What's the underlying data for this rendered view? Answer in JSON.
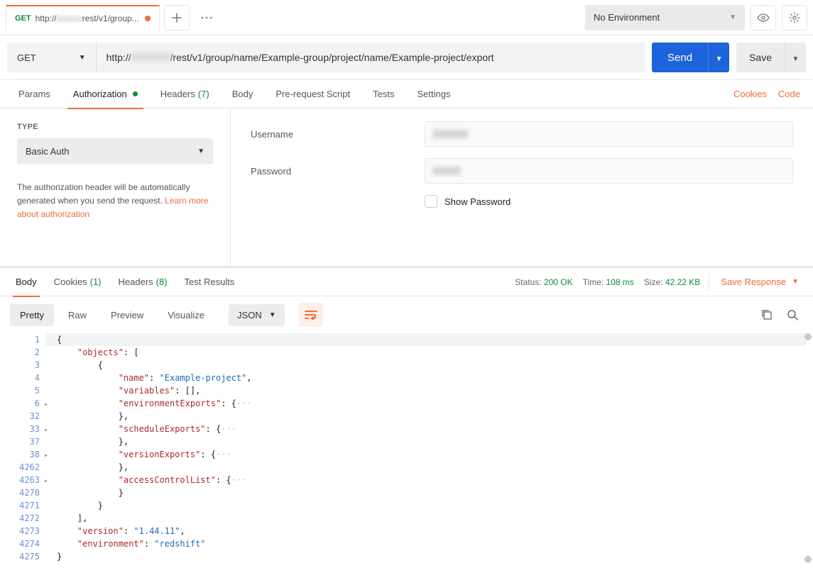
{
  "tab": {
    "method": "GET",
    "title_prefix": "http://",
    "title_blur": "xxxxxx",
    "title_suffix": "rest/v1/group..."
  },
  "env": {
    "label": "No Environment"
  },
  "request": {
    "method": "GET",
    "url_prefix": "http://",
    "url_suffix": "/rest/v1/group/name/Example-group/project/name/Example-project/export"
  },
  "buttons": {
    "send": "Send",
    "save": "Save"
  },
  "reqTabs": {
    "params": "Params",
    "auth": "Authorization",
    "headers": "Headers",
    "headers_count": "(7)",
    "body": "Body",
    "prerequest": "Pre-request Script",
    "tests": "Tests",
    "settings": "Settings",
    "cookies": "Cookies",
    "code": "Code"
  },
  "auth": {
    "type_label": "TYPE",
    "type_value": "Basic Auth",
    "desc_1": "The authorization header will be automatically generated when you send the request. ",
    "desc_link": "Learn more about authorization",
    "username_label": "Username",
    "password_label": "Password",
    "show_password": "Show Password"
  },
  "respTabs": {
    "body": "Body",
    "cookies": "Cookies",
    "cookies_count": "(1)",
    "headers": "Headers",
    "headers_count": "(8)",
    "tests": "Test Results"
  },
  "respMeta": {
    "status_label": "Status:",
    "status_value": "200 OK",
    "time_label": "Time:",
    "time_value": "108 ms",
    "size_label": "Size:",
    "size_value": "42.22 KB",
    "save_response": "Save Response"
  },
  "fmt": {
    "pretty": "Pretty",
    "raw": "Raw",
    "preview": "Preview",
    "visualize": "Visualize",
    "lang": "JSON"
  },
  "code": {
    "lines": [
      {
        "n": "1",
        "indent": 0,
        "content": [
          {
            "t": "p",
            "v": "{"
          }
        ],
        "hl": true
      },
      {
        "n": "2",
        "indent": 1,
        "content": [
          {
            "t": "k",
            "v": "\"objects\""
          },
          {
            "t": "p",
            "v": ": ["
          }
        ]
      },
      {
        "n": "3",
        "indent": 2,
        "content": [
          {
            "t": "p",
            "v": "{"
          }
        ]
      },
      {
        "n": "4",
        "indent": 3,
        "content": [
          {
            "t": "k",
            "v": "\"name\""
          },
          {
            "t": "p",
            "v": ": "
          },
          {
            "t": "s",
            "v": "\"Example-project\""
          },
          {
            "t": "p",
            "v": ","
          }
        ]
      },
      {
        "n": "5",
        "indent": 3,
        "content": [
          {
            "t": "k",
            "v": "\"variables\""
          },
          {
            "t": "p",
            "v": ": [],"
          }
        ]
      },
      {
        "n": "6",
        "indent": 3,
        "fold": true,
        "content": [
          {
            "t": "k",
            "v": "\"environmentExports\""
          },
          {
            "t": "p",
            "v": ": {"
          },
          {
            "t": "d",
            "v": "···"
          }
        ]
      },
      {
        "n": "32",
        "indent": 3,
        "content": [
          {
            "t": "p",
            "v": "},"
          }
        ]
      },
      {
        "n": "33",
        "indent": 3,
        "fold": true,
        "content": [
          {
            "t": "k",
            "v": "\"scheduleExports\""
          },
          {
            "t": "p",
            "v": ": {"
          },
          {
            "t": "d",
            "v": "···"
          }
        ]
      },
      {
        "n": "37",
        "indent": 3,
        "content": [
          {
            "t": "p",
            "v": "},"
          }
        ]
      },
      {
        "n": "38",
        "indent": 3,
        "fold": true,
        "content": [
          {
            "t": "k",
            "v": "\"versionExports\""
          },
          {
            "t": "p",
            "v": ": {"
          },
          {
            "t": "d",
            "v": "···"
          }
        ]
      },
      {
        "n": "4262",
        "indent": 3,
        "content": [
          {
            "t": "p",
            "v": "},"
          }
        ]
      },
      {
        "n": "4263",
        "indent": 3,
        "fold": true,
        "content": [
          {
            "t": "k",
            "v": "\"accessControlList\""
          },
          {
            "t": "p",
            "v": ": {"
          },
          {
            "t": "d",
            "v": "···"
          }
        ]
      },
      {
        "n": "4270",
        "indent": 3,
        "content": [
          {
            "t": "p",
            "v": "}"
          }
        ]
      },
      {
        "n": "4271",
        "indent": 2,
        "content": [
          {
            "t": "p",
            "v": "}"
          }
        ]
      },
      {
        "n": "4272",
        "indent": 1,
        "content": [
          {
            "t": "p",
            "v": "],"
          }
        ]
      },
      {
        "n": "4273",
        "indent": 1,
        "content": [
          {
            "t": "k",
            "v": "\"version\""
          },
          {
            "t": "p",
            "v": ": "
          },
          {
            "t": "s",
            "v": "\"1.44.11\""
          },
          {
            "t": "p",
            "v": ","
          }
        ]
      },
      {
        "n": "4274",
        "indent": 1,
        "content": [
          {
            "t": "k",
            "v": "\"environment\""
          },
          {
            "t": "p",
            "v": ": "
          },
          {
            "t": "s",
            "v": "\"redshift\""
          }
        ]
      },
      {
        "n": "4275",
        "indent": 0,
        "content": [
          {
            "t": "p",
            "v": "}"
          }
        ]
      }
    ]
  }
}
